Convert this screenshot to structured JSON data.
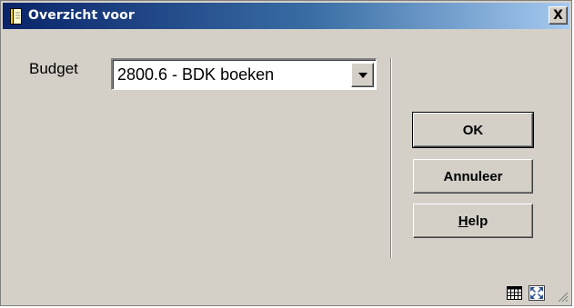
{
  "window": {
    "title": "Overzicht voor",
    "close_label": "X"
  },
  "form": {
    "budget_label": "Budget",
    "budget_value": "2800.6 - BDK boeken"
  },
  "buttons": {
    "ok_label": "OK",
    "cancel_label": "Annuleer",
    "help_label": "Help"
  },
  "icons": {
    "title_icon": "document-icon",
    "close_icon": "close-icon",
    "dropdown_icon": "chevron-down-icon",
    "grid_icon": "table-icon",
    "expand_icon": "expand-icon",
    "resize_icon": "resize-grip-icon"
  },
  "colors": {
    "title_gradient_start": "#0a246a",
    "title_gradient_end": "#a6caf0",
    "window_bg": "#d4d0c8"
  }
}
